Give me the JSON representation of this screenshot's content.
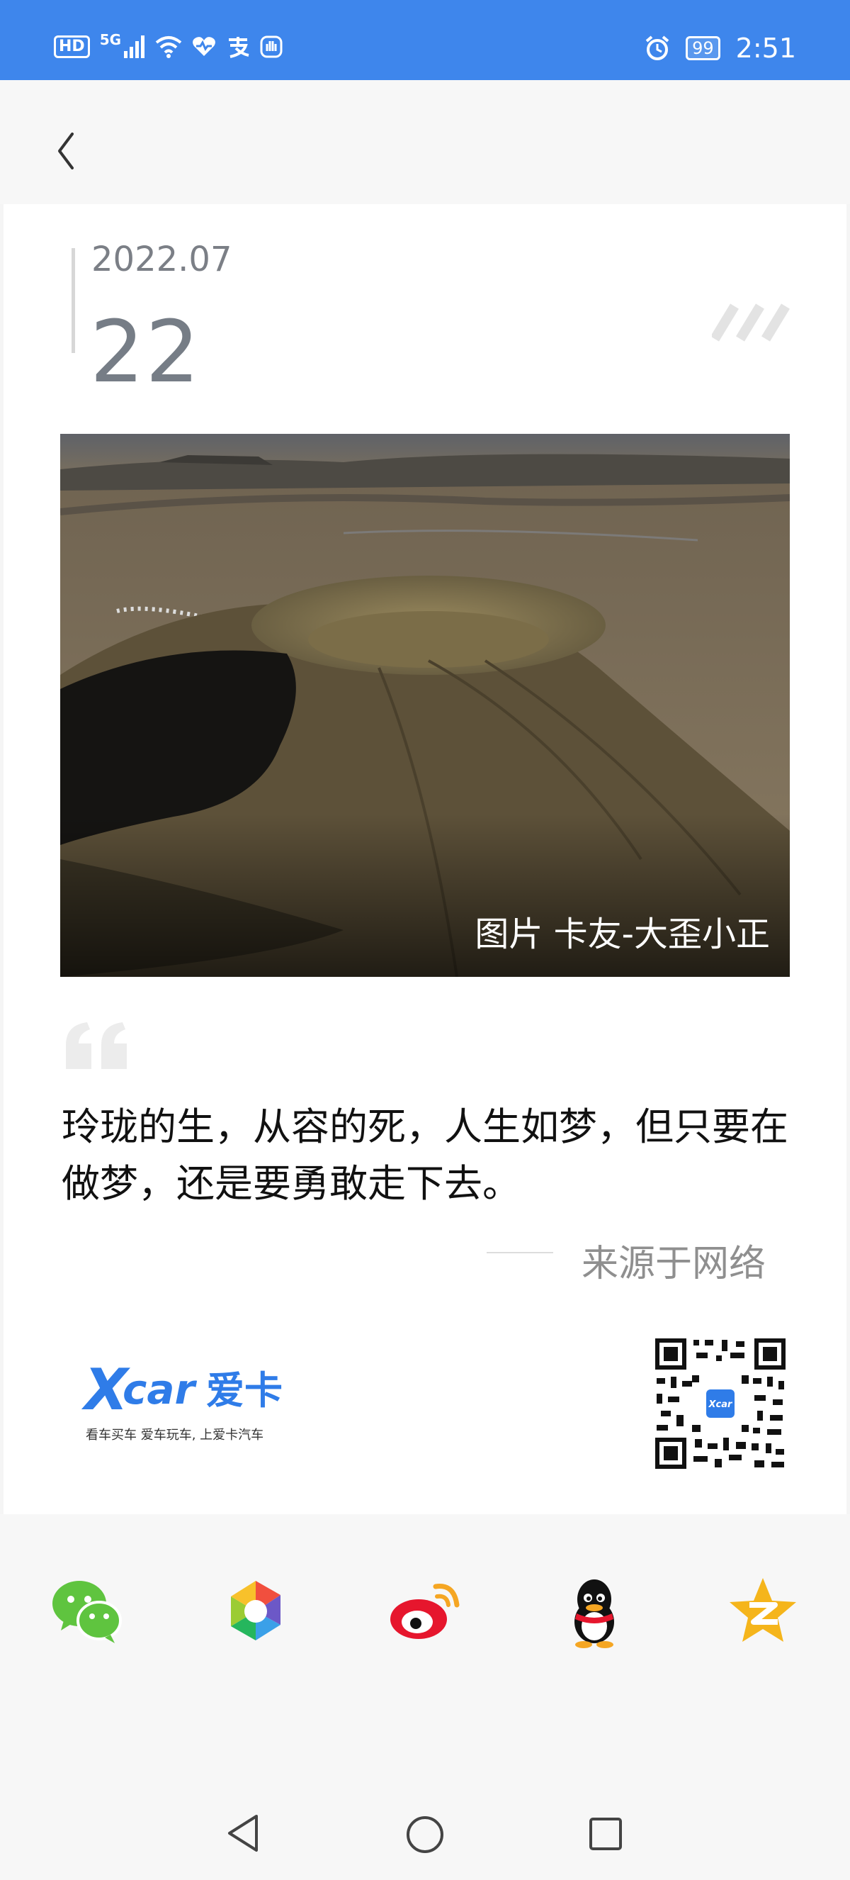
{
  "status_bar": {
    "network_badge": "HD",
    "network_type": "5G",
    "battery_level": "99",
    "time": "2:51"
  },
  "card": {
    "date_month": "2022.07",
    "date_day": "22",
    "photo_caption": "图片 卡友-大歪小正",
    "quote": "玲珑的生，从容的死，人生如梦，但只要在做梦，还是要勇敢走下去。",
    "source": "来源于网络",
    "slogan": "看车买车 爱车玩车, 上爱卡汽车"
  },
  "share_bar": {
    "targets": [
      "wechat-icon",
      "moments-icon",
      "weibo-icon",
      "qq-icon",
      "qzone-icon"
    ]
  },
  "colors": {
    "status_bar": "#3e86ec",
    "brand_blue": "#2f7ce8"
  }
}
